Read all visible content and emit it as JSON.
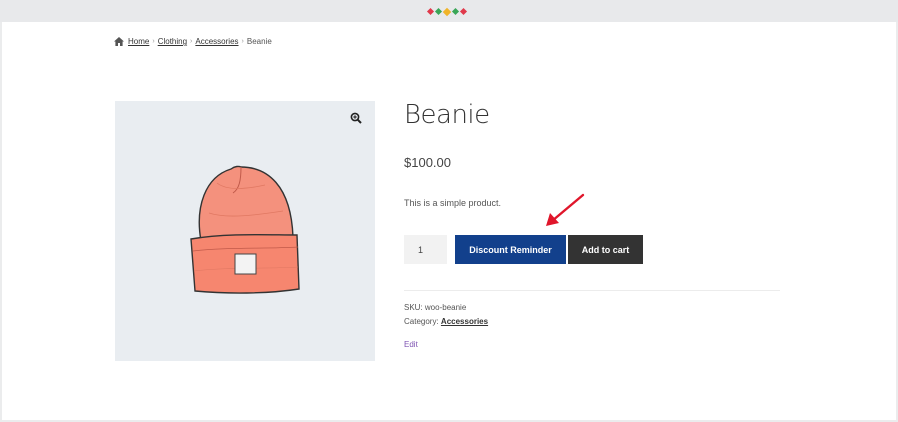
{
  "colors": {
    "primary_button": "#12408c",
    "secondary_button": "#333333",
    "link": "#7f54b3",
    "annotation_arrow": "#e0162b",
    "gallery_bg": "#e9edf1"
  },
  "breadcrumb": {
    "items": [
      "Home",
      "Clothing",
      "Accessories"
    ],
    "current": "Beanie",
    "separator": "›"
  },
  "product": {
    "title": "Beanie",
    "price": "$100.00",
    "description": "This is a simple product.",
    "quantity": "1",
    "discount_button_label": "Discount Reminder",
    "add_to_cart_label": "Add to cart",
    "sku_label": "SKU:",
    "sku_value": "woo-beanie",
    "category_label": "Category:",
    "category_value": "Accessories",
    "edit_label": "Edit",
    "image_icon": "beanie-product-image",
    "zoom_icon": "magnifier-plus-icon"
  },
  "header": {
    "logo_icon": "diamond-row-logo"
  }
}
